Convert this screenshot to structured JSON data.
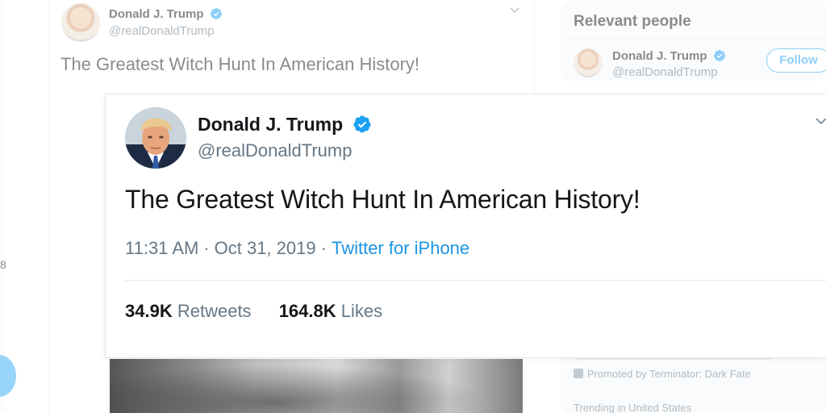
{
  "background": {
    "tweet": {
      "name": "Donald J. Trump",
      "handle": "@realDonaldTrump",
      "text": "The Greatest Witch Hunt In American History!"
    },
    "relevant_people": {
      "title": "Relevant people",
      "person": {
        "name": "Donald J. Trump",
        "handle": "@realDonaldTrump",
        "follow_label": "Follow"
      }
    },
    "trends": {
      "promoted": "Promoted by Terminator: Dark Fate",
      "trending": "Trending in United States"
    }
  },
  "tweet": {
    "author_name": "Donald J. Trump",
    "author_handle": "@realDonaldTrump",
    "verified": true,
    "text": "The Greatest Witch Hunt In American History!",
    "time": "11:31 AM",
    "date": "Oct 31, 2019",
    "separator": "·",
    "source": "Twitter for iPhone",
    "retweets": {
      "count": "34.9K",
      "label": "Retweets"
    },
    "likes": {
      "count": "164.8K",
      "label": "Likes"
    }
  },
  "colors": {
    "twitter_blue": "#1da1f2",
    "link_blue": "#1b95e0",
    "text_primary": "#14171a",
    "text_secondary": "#657786",
    "border": "#e1e8ed"
  },
  "icons": {
    "verified": "verified-badge-icon",
    "caret": "chevron-down-icon",
    "promoted": "promoted-icon"
  }
}
